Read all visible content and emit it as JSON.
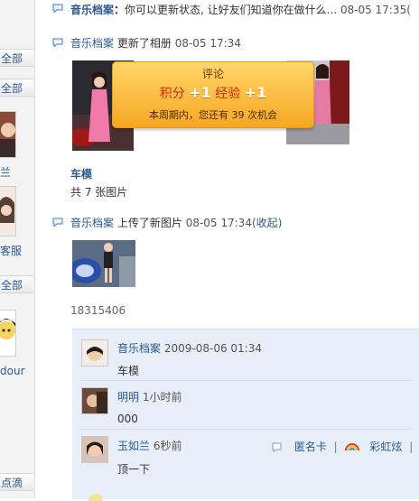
{
  "sidebar": {
    "all_label_1": "全部",
    "all_label_2": "全部",
    "all_label_3": "全部",
    "name_fragment_1": "兰",
    "name_fragment_2": "客服",
    "name_fragment_3": "dour",
    "bottom_label": "点滴"
  },
  "feed": {
    "status_item": {
      "user": "音乐档案",
      "text": "你可以更新状态, 让好友们知道你在做什么...",
      "time": "08-05 17:35("
    },
    "album_item": {
      "user": "音乐档案",
      "action": "更新了相册",
      "time": "08-05 17:34",
      "album_name": "车模",
      "photo_count": "共 7 张图片"
    },
    "upload_item": {
      "user": "音乐档案",
      "action": "上传了新图片",
      "time": "08-05 17:34(",
      "collect": "收起",
      "close_paren": ")",
      "photo_id": "18315406"
    }
  },
  "popup": {
    "title": "评论",
    "points_label": "积分",
    "points_value": "+1",
    "exp_label": "经验",
    "exp_value": "+1",
    "note": "本周期内，您还有  39 次机会"
  },
  "comments": [
    {
      "user": "音乐档案",
      "time": "2009-08-06 01:34",
      "text": "车模"
    },
    {
      "user": "明明",
      "time": "1小时前",
      "text": "000"
    },
    {
      "user": "玉如兰",
      "time": "6秒前",
      "text": "顶一下"
    }
  ],
  "comment_tools": {
    "anon_card": "匿名卡",
    "sep": "|",
    "rainbow": "彩虹炫",
    "sep2": "|"
  }
}
